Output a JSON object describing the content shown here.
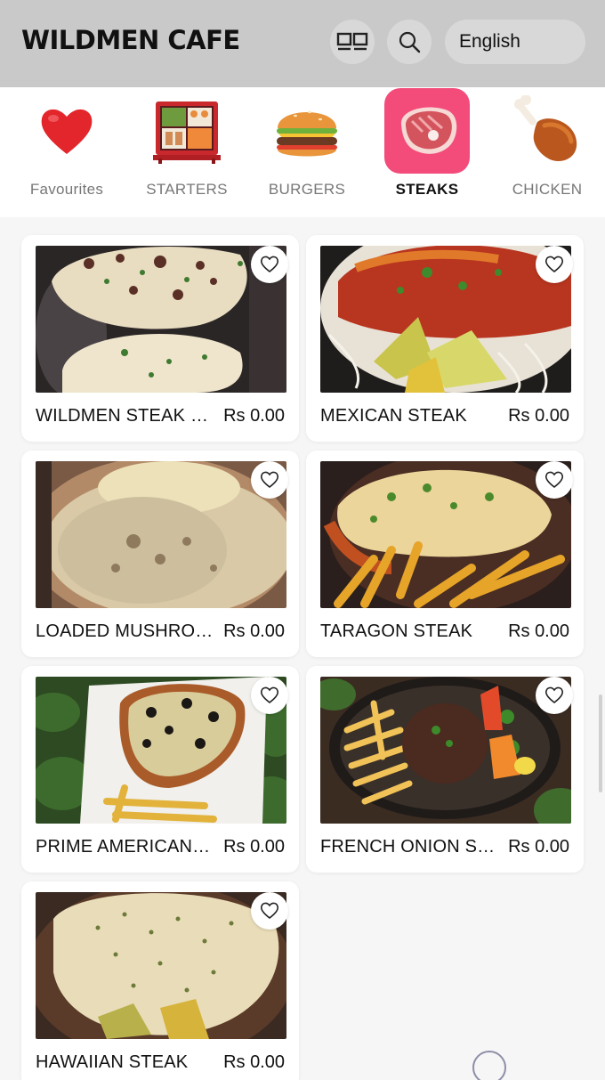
{
  "header": {
    "brand": "WILDMEN CAFE",
    "layout_icon": "grid-layout-icon",
    "search_icon": "search-icon",
    "language": "English"
  },
  "categories": [
    {
      "label": "Favourites",
      "icon": "heart-icon",
      "active": false
    },
    {
      "label": "STARTERS",
      "icon": "bento-box-icon",
      "active": false
    },
    {
      "label": "BURGERS",
      "icon": "burger-icon",
      "active": false
    },
    {
      "label": "STEAKS",
      "icon": "steak-icon",
      "active": true
    },
    {
      "label": "CHICKEN",
      "icon": "chicken-leg-icon",
      "active": false
    }
  ],
  "items": [
    {
      "name": "WILDMEN STEAK SPE...",
      "price": "Rs 0.00"
    },
    {
      "name": "MEXICAN STEAK",
      "price": "Rs 0.00"
    },
    {
      "name": "LOADED MUSHROOM ...",
      "price": "Rs 0.00"
    },
    {
      "name": "TARAGON STEAK",
      "price": "Rs 0.00"
    },
    {
      "name": "PRIME AMERICAN ST...",
      "price": "Rs 0.00"
    },
    {
      "name": "FRENCH ONION STEAK",
      "price": "Rs 0.00"
    },
    {
      "name": "HAWAIIAN STEAK",
      "price": "Rs 0.00"
    }
  ],
  "colors": {
    "header_bg": "#c9c9c9",
    "active_category_bg": "#f34b7a"
  }
}
